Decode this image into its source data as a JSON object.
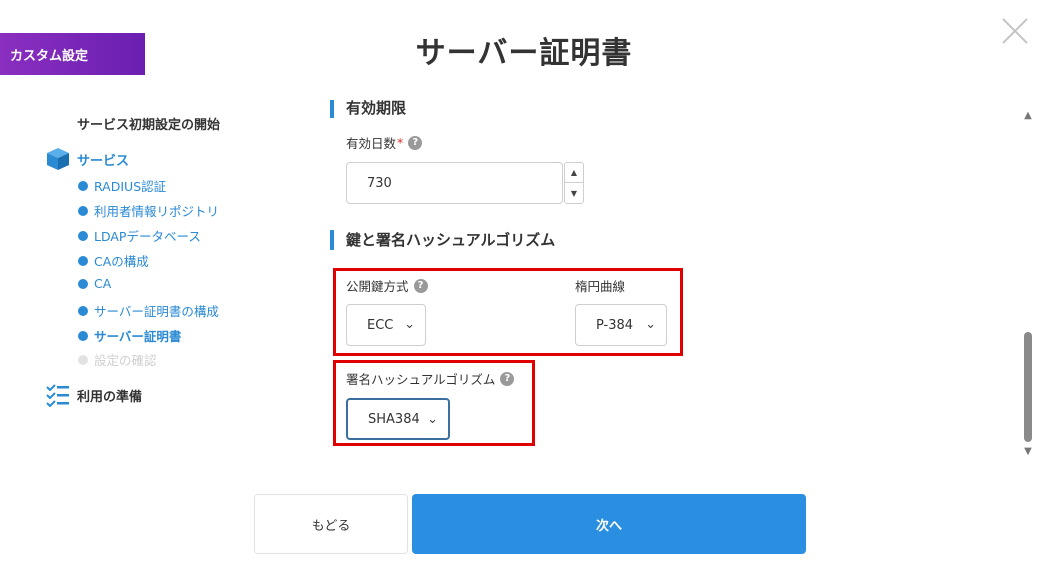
{
  "badge": {
    "label": "カスタム設定"
  },
  "header": {
    "title": "サーバー証明書"
  },
  "sidebar": {
    "start_label": "サービス初期設定の開始",
    "service_group": "サービス",
    "items": [
      {
        "label": "RADIUS認証",
        "state": "done"
      },
      {
        "label": "利用者情報リポジトリ",
        "state": "done"
      },
      {
        "label": "LDAPデータベース",
        "state": "done"
      },
      {
        "label": "CAの構成",
        "state": "done"
      },
      {
        "label": "CA",
        "state": "done"
      },
      {
        "label": "サーバー証明書の構成",
        "state": "done"
      },
      {
        "label": "サーバー証明書",
        "state": "current"
      },
      {
        "label": "設定の確認",
        "state": "pending"
      }
    ],
    "prep_group": "利用の準備"
  },
  "form": {
    "validity_section": "有効期限",
    "validity_days": {
      "label": "有効日数",
      "required_mark": "*",
      "value": "730"
    },
    "key_section": "鍵と署名ハッシュアルゴリズム",
    "public_key": {
      "label": "公開鍵方式",
      "selected": "ECC"
    },
    "curve": {
      "label": "楕円曲線",
      "selected": "P-384"
    },
    "sig_hash": {
      "label": "署名ハッシュアルゴリズム",
      "selected": "SHA384"
    }
  },
  "footer": {
    "back_label": "もどる",
    "next_label": "次へ"
  },
  "colors": {
    "accent": "#2a8fe0",
    "badge": "#7a28b8",
    "highlight": "#e00000"
  }
}
